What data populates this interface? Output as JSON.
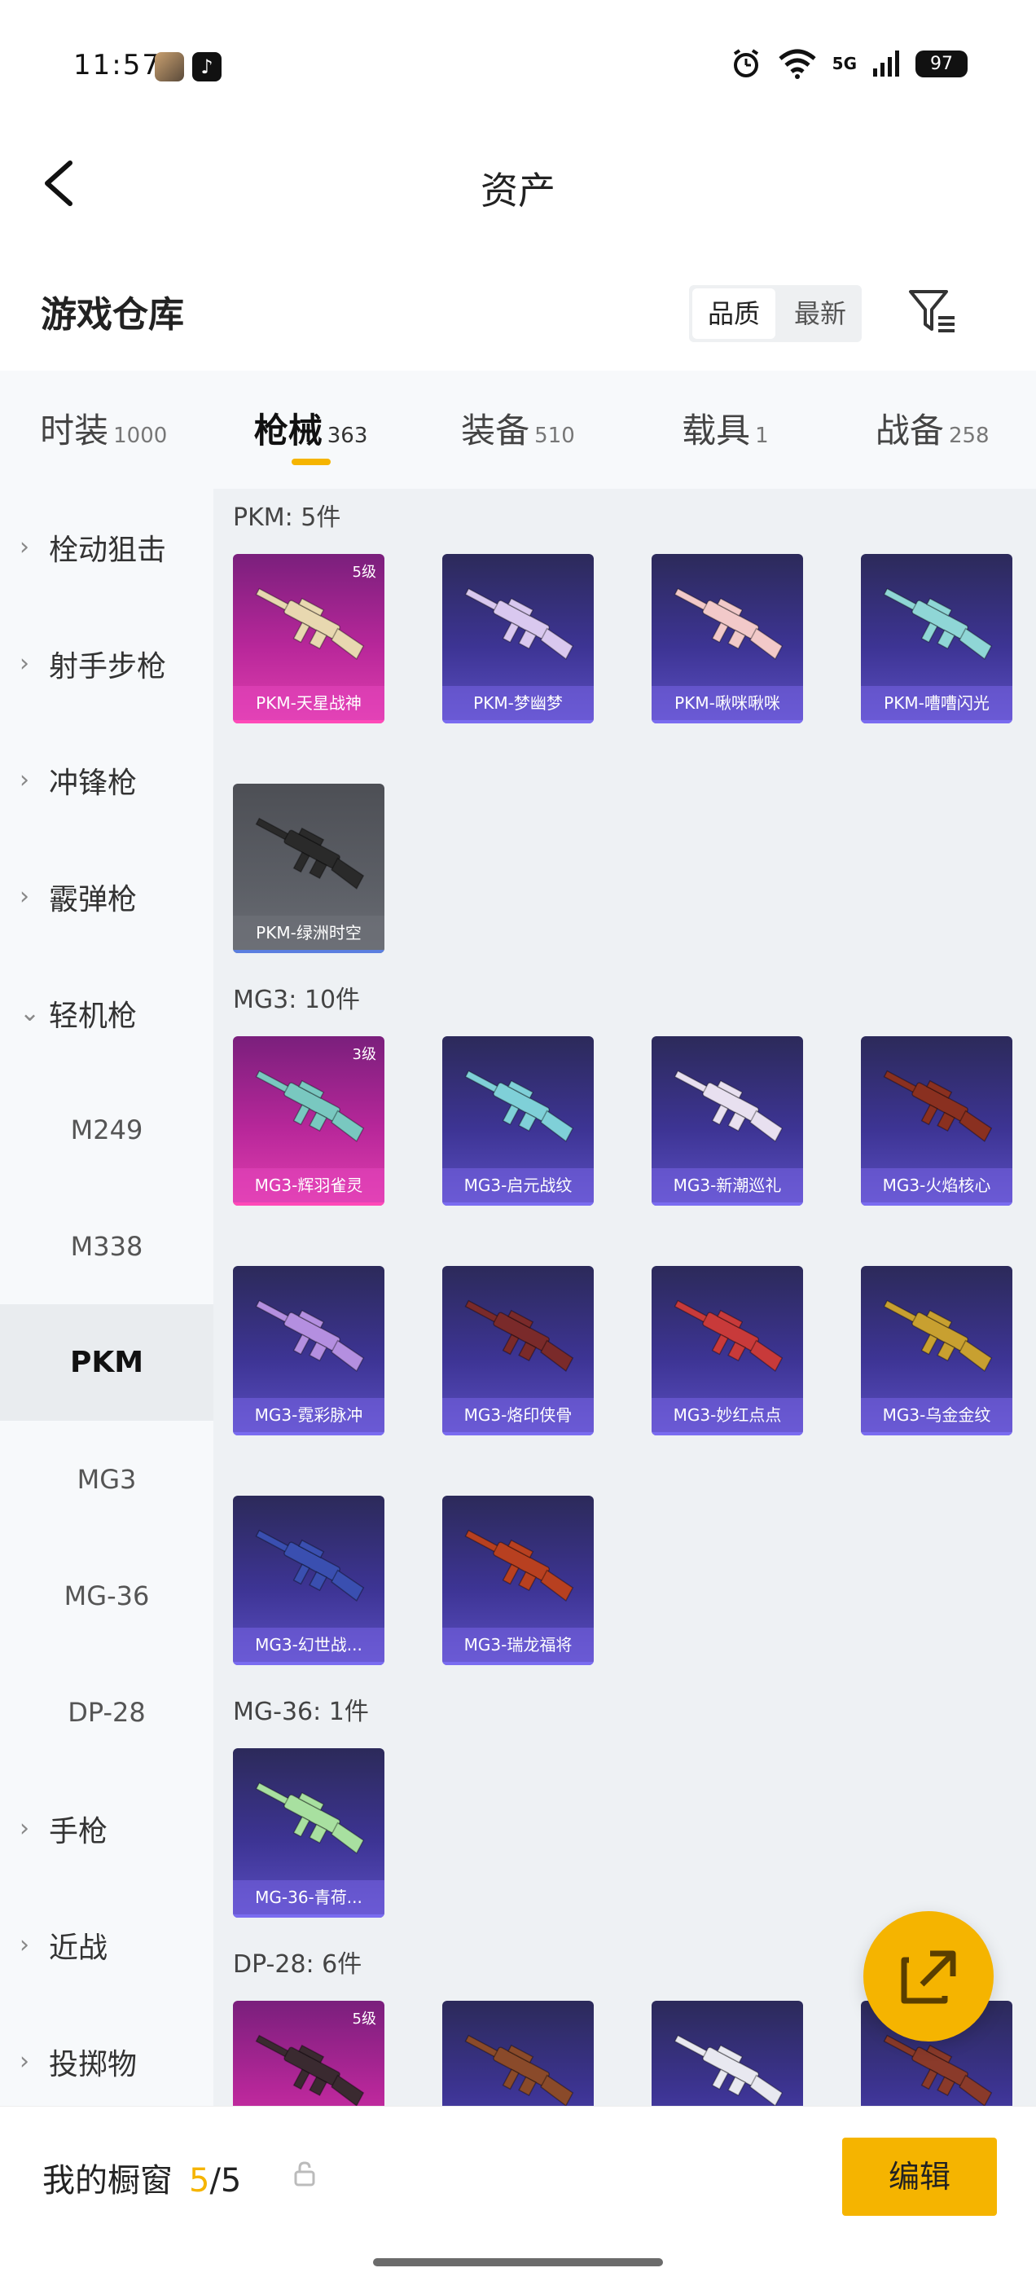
{
  "status_bar": {
    "time": "11:57",
    "tiktok_glyph": "♪",
    "network": "5G",
    "battery": "97"
  },
  "header": {
    "title": "资产"
  },
  "warehouse": {
    "title": "游戏仓库",
    "sort_options": [
      "品质",
      "最新"
    ],
    "active_sort": 0
  },
  "tabs": [
    {
      "name": "时装",
      "count": "1000",
      "active": false
    },
    {
      "name": "枪械",
      "count": "363",
      "active": true
    },
    {
      "name": "装备",
      "count": "510",
      "active": false
    },
    {
      "name": "载具",
      "count": "1",
      "active": false
    },
    {
      "name": "战备",
      "count": "258",
      "active": false
    }
  ],
  "sidebar": {
    "items": [
      {
        "label": "栓动狙击",
        "type": "category",
        "chevron": "›"
      },
      {
        "label": "射手步枪",
        "type": "category",
        "chevron": "›"
      },
      {
        "label": "冲锋枪",
        "type": "category",
        "chevron": "›"
      },
      {
        "label": "霰弹枪",
        "type": "category",
        "chevron": "›"
      },
      {
        "label": "轻机枪",
        "type": "category",
        "chevron": "⌄",
        "expanded": true
      },
      {
        "label": "M249",
        "type": "sub"
      },
      {
        "label": "M338",
        "type": "sub"
      },
      {
        "label": "PKM",
        "type": "sub",
        "selected": true
      },
      {
        "label": "MG3",
        "type": "sub"
      },
      {
        "label": "MG-36",
        "type": "sub"
      },
      {
        "label": "DP-28",
        "type": "sub"
      },
      {
        "label": "手枪",
        "type": "category",
        "chevron": "›"
      },
      {
        "label": "近战",
        "type": "category",
        "chevron": "›"
      },
      {
        "label": "投掷物",
        "type": "category",
        "chevron": "›"
      }
    ]
  },
  "sections": [
    {
      "label": "PKM: 5件",
      "items": [
        {
          "name": "PKM-天星战神",
          "rarity": "pink",
          "level": "5级",
          "gun_color": "#e8d8b0"
        },
        {
          "name": "PKM-梦幽梦",
          "rarity": "purple",
          "gun_color": "#d9c8ef"
        },
        {
          "name": "PKM-啾咪啾咪",
          "rarity": "purple",
          "gun_color": "#f2c9c9"
        },
        {
          "name": "PKM-嘈嘈闪光",
          "rarity": "purple",
          "gun_color": "#8fd6d6"
        },
        {
          "name": "PKM-绿洲时空",
          "rarity": "grey",
          "gun_color": "#2a2a2a"
        }
      ]
    },
    {
      "label": "MG3: 10件",
      "items": [
        {
          "name": "MG3-辉羽雀灵",
          "rarity": "pink",
          "level": "3级",
          "gun_color": "#79c8c0"
        },
        {
          "name": "MG3-启元战纹",
          "rarity": "purple",
          "gun_color": "#7fd0d8"
        },
        {
          "name": "MG3-新潮巡礼",
          "rarity": "purple",
          "gun_color": "#e8e0f0"
        },
        {
          "name": "MG3-火焰核心",
          "rarity": "purple",
          "gun_color": "#8a3020"
        },
        {
          "name": "MG3-霓彩脉冲",
          "rarity": "purple",
          "gun_color": "#b48fe0"
        },
        {
          "name": "MG3-烙印侠骨",
          "rarity": "purple",
          "gun_color": "#7a2a2a"
        },
        {
          "name": "MG3-妙红点点",
          "rarity": "purple",
          "gun_color": "#c83a3a"
        },
        {
          "name": "MG3-乌金金纹",
          "rarity": "purple",
          "gun_color": "#c8a030"
        },
        {
          "name": "MG3-幻世战...",
          "rarity": "purple",
          "gun_color": "#3a4fb0"
        },
        {
          "name": "MG3-瑞龙福将",
          "rarity": "purple",
          "gun_color": "#b84020"
        }
      ]
    },
    {
      "label": "MG-36: 1件",
      "items": [
        {
          "name": "MG-36-青荷...",
          "rarity": "purple",
          "gun_color": "#a8e0a0"
        }
      ]
    },
    {
      "label": "DP-28: 6件",
      "items": [
        {
          "name": "",
          "rarity": "pink",
          "level": "5级",
          "gun_color": "#3a2a30"
        },
        {
          "name": "",
          "rarity": "purple",
          "gun_color": "#8a4a2a"
        },
        {
          "name": "",
          "rarity": "purple",
          "gun_color": "#e8e8f0"
        },
        {
          "name": "",
          "rarity": "purple",
          "gun_color": "#8a3a2a"
        }
      ]
    }
  ],
  "bottom_bar": {
    "showcase_label": "我的橱窗",
    "count_current": "5",
    "count_sep_total": "/5",
    "edit_label": "编辑"
  }
}
